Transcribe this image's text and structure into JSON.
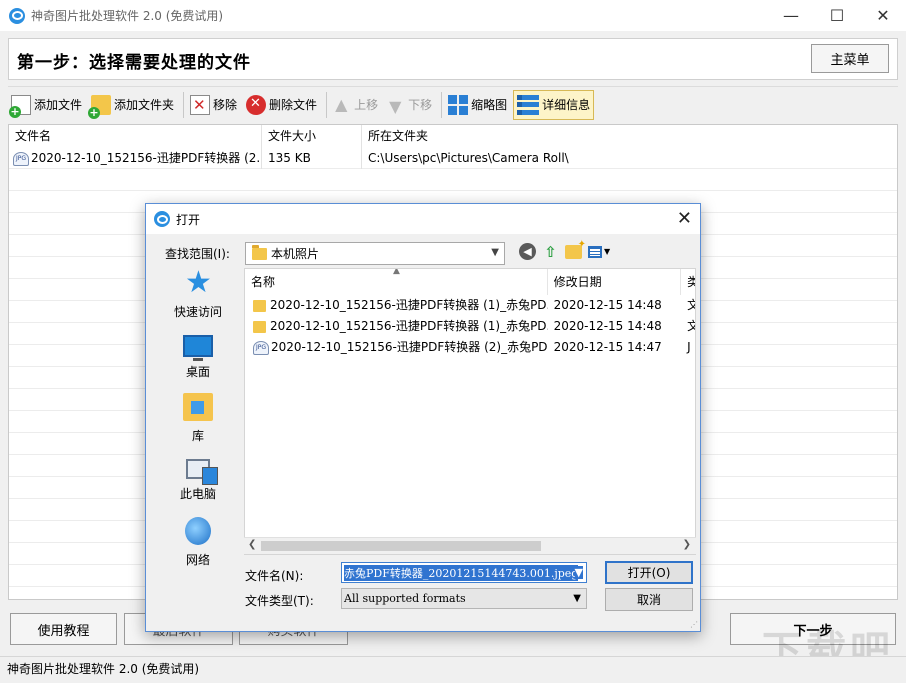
{
  "window": {
    "title": "神奇图片批处理软件 2.0 (免费试用)",
    "controls": {
      "minimize": "—",
      "maximize": "☐",
      "close": "✕"
    }
  },
  "header": {
    "step_title": "第一步：选择需要处理的文件",
    "main_menu": "主菜单"
  },
  "toolbar": {
    "add_file": "添加文件",
    "add_folder": "添加文件夹",
    "remove": "移除",
    "delete_file": "删除文件",
    "move_up": "上移",
    "move_down": "下移",
    "thumbnail": "缩略图",
    "details": "详细信息"
  },
  "filelist": {
    "columns": [
      "文件名",
      "文件大小",
      "所在文件夹"
    ],
    "rows": [
      {
        "name": "2020-12-10_152156-迅捷PDF转换器 (2...",
        "size": "135 KB",
        "folder": "C:\\Users\\pc\\Pictures\\Camera Roll\\"
      }
    ]
  },
  "bottom": {
    "tutorial": "使用教程",
    "btn2": "最后软件",
    "btn3": "购买软件",
    "next": "下一步",
    "status": "神奇图片批处理软件 2.0 (免费试用)",
    "watermark": "下载吧"
  },
  "dialog": {
    "title": "打开",
    "close": "✕",
    "look_in_label": "查找范围(I):",
    "look_in_value": "本机照片",
    "places": [
      "快速访问",
      "桌面",
      "库",
      "此电脑",
      "网络"
    ],
    "columns": [
      "名称",
      "修改日期",
      "类"
    ],
    "files": [
      {
        "icon": "folder",
        "name": "2020-12-10_152156-迅捷PDF转换器 (1)_赤兔PD...",
        "date": "2020-12-15 14:48",
        "type": "文"
      },
      {
        "icon": "folder",
        "name": "2020-12-10_152156-迅捷PDF转换器 (1)_赤兔PD...",
        "date": "2020-12-15 14:48",
        "type": "文"
      },
      {
        "icon": "jpg",
        "name": "2020-12-10_152156-迅捷PDF转换器 (2)_赤兔PD...",
        "date": "2020-12-15 14:47",
        "type": "J"
      }
    ],
    "filename_label": "文件名(N):",
    "filename_value": "赤兔PDF转换器_20201215144743.001.jpeg",
    "filetype_label": "文件类型(T):",
    "filetype_value": "All supported formats",
    "open_button": "打开(O)",
    "cancel_button": "取消"
  },
  "icons": {
    "jpg_label": "JPG"
  },
  "colors": {
    "accent": "#2b8fe0",
    "selection": "#3074d0",
    "active_tool": "#fdf4c8"
  }
}
